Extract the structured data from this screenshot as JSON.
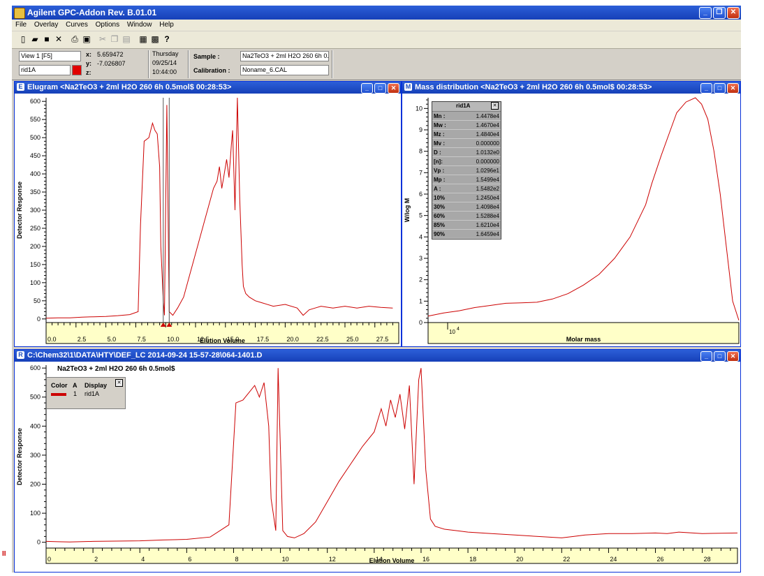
{
  "app": {
    "title": "Agilent GPC-Addon  Rev. B.01.01"
  },
  "menu": [
    "File",
    "Overlay",
    "Curves",
    "Options",
    "Window",
    "Help"
  ],
  "toolbar_icons": [
    "new-icon",
    "open-icon",
    "save-icon",
    "delete-icon",
    "print-icon",
    "print-preview-icon",
    "cut-icon",
    "copy-icon",
    "paste-icon",
    "window-icon",
    "properties-icon",
    "help-icon"
  ],
  "info": {
    "view": "View 1 [F5]",
    "signal": "rid1A",
    "x_label": "x:",
    "x_value": "5.659472",
    "y_label": "y:",
    "y_value": "-7.026807",
    "z_label": "z:",
    "day": "Thursday",
    "date": "09/25/14",
    "time": "10:44:00",
    "sample_label": "Sample :",
    "sample_value": "Na2TeO3 + 2ml H2O 260 6h 0.5",
    "calibration_label": "Calibration :",
    "calibration_value": "Noname_6.CAL"
  },
  "elugram": {
    "title": "Elugram <Na2TeO3 + 2ml H2O 260 6h 0.5mol$  00:28:53>",
    "icon": "E"
  },
  "massdist": {
    "title": "Mass distribution <Na2TeO3 + 2ml H2O 260 6h 0.5mol$  00:28:53>",
    "icon": "M",
    "stats_header": "rid1A",
    "stats": [
      {
        "k": "Mn :",
        "v": "1.4478e4"
      },
      {
        "k": "Mw :",
        "v": "1.4670e4"
      },
      {
        "k": "Mz :",
        "v": "1.4840e4"
      },
      {
        "k": "Mv :",
        "v": "0.000000"
      },
      {
        "k": "D :",
        "v": "1.0132e0"
      },
      {
        "k": "[n]:",
        "v": "0.000000"
      },
      {
        "k": "Vp :",
        "v": "1.0296e1"
      },
      {
        "k": "Mp :",
        "v": "1.5499e4"
      },
      {
        "k": "A :",
        "v": "1.5482e2"
      },
      {
        "k": "10%",
        "v": "1.2450e4"
      },
      {
        "k": "30%",
        "v": "1.4098e4"
      },
      {
        "k": "60%",
        "v": "1.5288e4"
      },
      {
        "k": "85%",
        "v": "1.6210e4"
      },
      {
        "k": "90%",
        "v": "1.6459e4"
      }
    ]
  },
  "raw": {
    "title": "C:\\Chem32\\1\\DATA\\HTY\\DEF_LC 2014-09-24 15-57-28\\064-1401.D",
    "icon": "R",
    "sample_title": "Na2TeO3 + 2ml H2O 260 6h 0.5mol$",
    "legend_header": [
      "Color",
      "A",
      "Display"
    ],
    "legend_row": {
      "a": "1",
      "display": "rid1A"
    }
  },
  "chart_data": [
    {
      "type": "line",
      "name": "elugram",
      "xlabel": "Elution Volume",
      "ylabel": "Detector Response",
      "xlim": [
        0,
        29.5
      ],
      "ylim": [
        -10,
        610
      ],
      "x_ticks": [
        "0.0",
        "2.5",
        "5.0",
        "7.5",
        "10.0",
        "12.5",
        "15.0",
        "17.5",
        "20.0",
        "22.5",
        "25.0",
        "27.5"
      ],
      "y_ticks": [
        "0",
        "50",
        "100",
        "150",
        "200",
        "250",
        "300",
        "350",
        "400",
        "450",
        "500",
        "550",
        "600"
      ],
      "x": [
        0,
        1,
        2,
        3,
        4,
        5,
        6,
        7,
        7.7,
        7.9,
        8.2,
        8.6,
        8.9,
        9.1,
        9.3,
        9.5,
        9.6,
        9.8,
        9.9,
        10.1,
        10.3,
        10.6,
        11,
        11.5,
        12,
        12.5,
        13,
        13.5,
        14,
        14.3,
        14.5,
        14.7,
        14.9,
        15.1,
        15.3,
        15.5,
        15.6,
        15.8,
        16,
        16.2,
        16.4,
        16.5,
        16.7,
        17,
        17.5,
        18,
        19,
        20,
        21,
        21.5,
        22,
        22.5,
        23,
        24,
        25,
        26,
        27,
        28,
        29
      ],
      "y": [
        2,
        3,
        3,
        5,
        6,
        7,
        9,
        12,
        20,
        260,
        490,
        500,
        540,
        520,
        510,
        420,
        200,
        50,
        10,
        590,
        20,
        10,
        30,
        60,
        120,
        180,
        240,
        300,
        360,
        380,
        420,
        360,
        400,
        440,
        390,
        480,
        520,
        300,
        610,
        330,
        150,
        90,
        70,
        60,
        50,
        45,
        35,
        40,
        30,
        10,
        25,
        30,
        35,
        30,
        35,
        30,
        35,
        32,
        30
      ]
    },
    {
      "type": "line",
      "name": "mass-distribution",
      "xlabel": "Molar mass",
      "ylabel": "W/log M",
      "ylim": [
        0,
        10.5
      ],
      "x_tick_labels": [
        "10^4"
      ],
      "y_ticks": [
        "0",
        "1",
        "2",
        "3",
        "4",
        "5",
        "6",
        "7",
        "8",
        "9",
        "10"
      ],
      "x": [
        0,
        0.05,
        0.1,
        0.15,
        0.2,
        0.25,
        0.3,
        0.35,
        0.4,
        0.45,
        0.5,
        0.55,
        0.6,
        0.65,
        0.7,
        0.72,
        0.75,
        0.78,
        0.8,
        0.83,
        0.86,
        0.88,
        0.9,
        0.92,
        0.94,
        0.96,
        0.98,
        1
      ],
      "y": [
        0.3,
        0.45,
        0.55,
        0.7,
        0.8,
        0.9,
        0.92,
        0.95,
        1.1,
        1.35,
        1.75,
        2.25,
        3.0,
        4.0,
        5.5,
        6.5,
        7.8,
        9.0,
        9.8,
        10.3,
        10.5,
        10.2,
        9.5,
        8.0,
        6.0,
        3.5,
        1.0,
        0.1
      ]
    },
    {
      "type": "line",
      "name": "raw-chromatogram",
      "xlabel": "Elution Volume",
      "ylabel": "Detector Response",
      "xlim": [
        0,
        29.5
      ],
      "ylim": [
        -20,
        610
      ],
      "x_ticks": [
        "0",
        "2",
        "4",
        "6",
        "8",
        "10",
        "12",
        "14",
        "16",
        "18",
        "20",
        "22",
        "24",
        "26",
        "28"
      ],
      "y_ticks": [
        "0",
        "100",
        "200",
        "300",
        "400",
        "500",
        "600"
      ],
      "series": [
        {
          "name": "rid1A",
          "color": "#cc0000"
        }
      ],
      "x": [
        0,
        0.5,
        1,
        2,
        3,
        4,
        5,
        6,
        7,
        7.8,
        8.1,
        8.4,
        8.7,
        8.9,
        9.1,
        9.3,
        9.5,
        9.6,
        9.8,
        9.9,
        10.1,
        10.3,
        10.6,
        11,
        11.5,
        12,
        12.5,
        13,
        13.5,
        14,
        14.3,
        14.5,
        14.7,
        14.9,
        15.1,
        15.3,
        15.5,
        15.7,
        15.9,
        16,
        16.2,
        16.4,
        16.6,
        17,
        17.5,
        18,
        19,
        20,
        21,
        22,
        22.5,
        23,
        24,
        25,
        26,
        26.5,
        27,
        28,
        29.5
      ],
      "y": [
        3,
        2,
        1,
        3,
        4,
        5,
        8,
        10,
        18,
        60,
        480,
        490,
        520,
        540,
        500,
        550,
        400,
        150,
        40,
        600,
        40,
        20,
        15,
        30,
        70,
        140,
        210,
        270,
        330,
        380,
        460,
        400,
        490,
        430,
        510,
        390,
        540,
        200,
        560,
        600,
        250,
        80,
        55,
        45,
        40,
        35,
        30,
        25,
        20,
        15,
        20,
        25,
        30,
        30,
        32,
        30,
        35,
        30,
        32
      ]
    }
  ]
}
